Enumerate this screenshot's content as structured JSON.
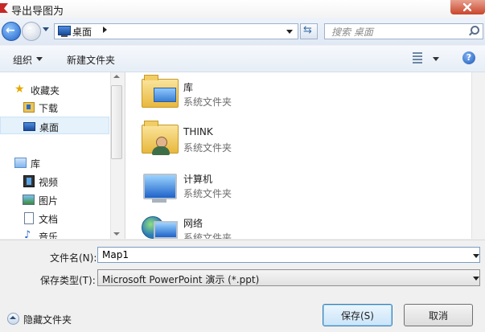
{
  "window": {
    "title": "导出导图为"
  },
  "address": {
    "location": "桌面"
  },
  "search": {
    "placeholder": "搜索 桌面"
  },
  "toolbar": {
    "organize_label": "组织",
    "new_folder_label": "新建文件夹",
    "help_glyph": "?"
  },
  "nav": {
    "favorites_label": "收藏夹",
    "downloads_label": "下载",
    "desktop_label": "桌面",
    "libraries_label": "库",
    "videos_label": "视频",
    "pictures_label": "图片",
    "documents_label": "文档",
    "music_label": "音乐",
    "selected": "桌面"
  },
  "files": [
    {
      "name": "库",
      "type": "系统文件夹",
      "icon": "library-folder-icon"
    },
    {
      "name": "THINK",
      "type": "系统文件夹",
      "icon": "user-folder-icon"
    },
    {
      "name": "计算机",
      "type": "系统文件夹",
      "icon": "computer-icon"
    },
    {
      "name": "网络",
      "type": "系统文件夹",
      "icon": "network-icon"
    }
  ],
  "form": {
    "filename_label": "文件名(N):",
    "filename_value": "Map1",
    "type_label": "保存类型(T):",
    "type_value": "Microsoft PowerPoint 演示 (*.ppt)"
  },
  "footer": {
    "hide_folders_label": "隐藏文件夹",
    "save_label": "保存(S)",
    "cancel_label": "取消"
  },
  "colors": {
    "accent": "#1f63c9",
    "selection": "#e5f1fb",
    "save_border": "#3c7fb1"
  }
}
